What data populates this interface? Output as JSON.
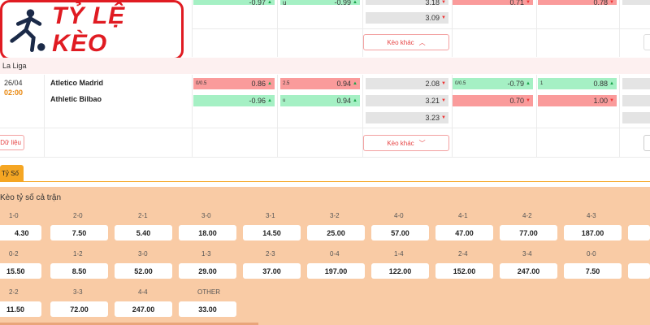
{
  "logo": {
    "text": "TỶ LỆ KÈO"
  },
  "more_button": {
    "label": "Kèo khác"
  },
  "league": {
    "name": "La Liga"
  },
  "top_match": {
    "rows": [
      {
        "ah_label": "",
        "ah_val": "-0.97",
        "ou_label": "u",
        "ou_val": "-0.99",
        "x12": "3.18",
        "c1_val": "0.71",
        "c2_val": "0.78"
      },
      {
        "x12": "3.09"
      }
    ]
  },
  "match": {
    "date": "26/04",
    "time": "02:00",
    "home": "Atletico Madrid",
    "away": "Athletic Bilbao",
    "data_label": "Dữ liệu",
    "home_row": {
      "ah_label": "0/0.5",
      "ah_val": "0.86",
      "ou_label": "2.5",
      "ou_val": "0.94",
      "x12": "2.08",
      "h1_label": "0/0.5",
      "h1_val": "-0.79",
      "h2_label": "1",
      "h2_val": "0.88"
    },
    "away_row": {
      "ah_val": "-0.96",
      "ou_label": "u",
      "ou_val": "0.94",
      "x12": "3.21",
      "h1_val": "0.70",
      "h2_val": "1.00"
    },
    "draw_row": {
      "x12": "3.23"
    }
  },
  "tab": {
    "label": "Tỷ Số"
  },
  "correct_score": {
    "title": "Kèo tỷ số cả trận",
    "rows": [
      [
        {
          "s": "1-0",
          "o": "4.30"
        },
        {
          "s": "2-0",
          "o": "7.50"
        },
        {
          "s": "2-1",
          "o": "5.40"
        },
        {
          "s": "3-0",
          "o": "18.00"
        },
        {
          "s": "3-1",
          "o": "14.50"
        },
        {
          "s": "3-2",
          "o": "25.00"
        },
        {
          "s": "4-0",
          "o": "57.00"
        },
        {
          "s": "4-1",
          "o": "47.00"
        },
        {
          "s": "4-2",
          "o": "77.00"
        },
        {
          "s": "4-3",
          "o": "187.00"
        }
      ],
      [
        {
          "s": "0-2",
          "o": "15.50"
        },
        {
          "s": "1-2",
          "o": "8.50"
        },
        {
          "s": "3-0",
          "o": "52.00"
        },
        {
          "s": "1-3",
          "o": "29.00"
        },
        {
          "s": "2-3",
          "o": "37.00"
        },
        {
          "s": "0-4",
          "o": "197.00"
        },
        {
          "s": "1-4",
          "o": "122.00"
        },
        {
          "s": "2-4",
          "o": "152.00"
        },
        {
          "s": "3-4",
          "o": "247.00"
        },
        {
          "s": "0-0",
          "o": "7.50"
        }
      ],
      [
        {
          "s": "2-2",
          "o": "11.50"
        },
        {
          "s": "3-3",
          "o": "72.00"
        },
        {
          "s": "4-4",
          "o": "247.00"
        },
        {
          "s": "OTHER",
          "o": "33.00"
        }
      ]
    ]
  }
}
